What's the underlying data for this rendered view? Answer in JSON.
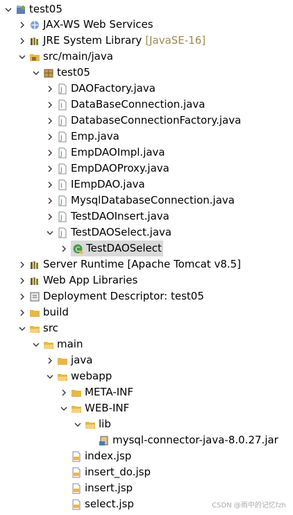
{
  "tree": {
    "project": "test05",
    "jax_ws": "JAX-WS Web Services",
    "jre_lib": "JRE System Library",
    "jre_decor": "[JavaSE-16]",
    "src_main_java": "src/main/java",
    "package_test05": "test05",
    "files": [
      "DAOFactory.java",
      "DataBaseConnection.java",
      "DatabaseConnectionFactory.java",
      "Emp.java",
      "EmpDAOImpl.java",
      "EmpDAOProxy.java",
      "IEmpDAO.java",
      "MysqlDatabaseConnection.java",
      "TestDAOInsert.java",
      "TestDAOSelect.java"
    ],
    "class_testdaoselect": "TestDAOSelect",
    "server_runtime": "Server Runtime [Apache Tomcat v8.5]",
    "webapp_libs": "Web App Libraries",
    "deploy_desc": "Deployment Descriptor: test05",
    "build": "build",
    "src": "src",
    "main": "main",
    "java": "java",
    "webapp": "webapp",
    "meta_inf": "META-INF",
    "web_inf": "WEB-INF",
    "lib": "lib",
    "jar": "mysql-connector-java-8.0.27.jar",
    "jsps": [
      "index.jsp",
      "insert_do.jsp",
      "insert.jsp",
      "select.jsp"
    ]
  },
  "watermark": "CSDN @雨中的记忆fzh",
  "colors": {
    "folder": "#e6b84a",
    "java": "#3a6fb0",
    "package": "#9a6a2a",
    "selected_bg": "#d9d9d9"
  }
}
